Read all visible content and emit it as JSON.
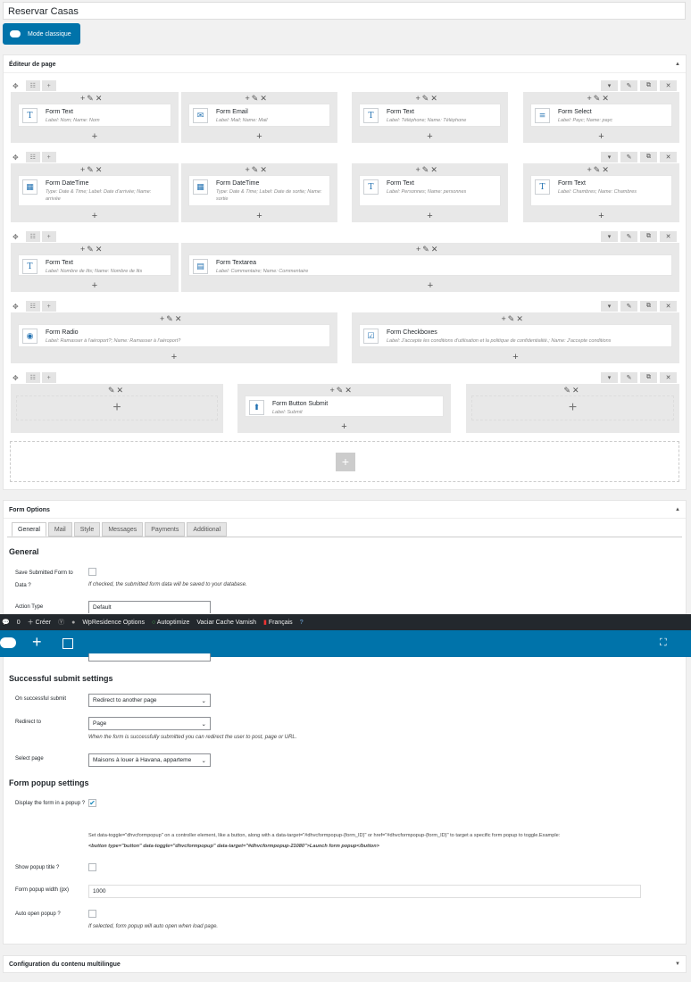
{
  "title": "Reservar Casas",
  "classic_mode": "Mode classique",
  "editor": {
    "title": "Éditeur de page",
    "rows": [
      {
        "cols": [
          {
            "name": "Form Text",
            "desc": "Label: Nom; Name: Nom",
            "icon": "T"
          },
          {
            "name": "Form Email",
            "desc": "Label: Mail; Name: Mail",
            "icon": "✉"
          },
          {
            "name": "Form Text",
            "desc": "Label: Téléphone; Name: Téléphone",
            "icon": "T"
          },
          {
            "name": "Form Select",
            "desc": "Label: Payс; Name: payc",
            "icon": "≡"
          }
        ]
      },
      {
        "cols": [
          {
            "name": "Form DateTime",
            "desc": "Type: Date & Time; Label: Date d'arrivée; Name: arrivée",
            "icon": "▦"
          },
          {
            "name": "Form DateTime",
            "desc": "Type: Date & Time; Label: Date de sortie; Name: sortie",
            "icon": "▦"
          },
          {
            "name": "Form Text",
            "desc": "Label: Personnes; Name: personnes",
            "icon": "T"
          },
          {
            "name": "Form Text",
            "desc": "Label: Chambres; Name: Chambres",
            "icon": "T"
          }
        ]
      },
      {
        "cols": [
          {
            "name": "Form Text",
            "desc": "Label: Nombre de lits; Name: Nombre de lits",
            "icon": "T"
          },
          {
            "name": "Form Textarea",
            "desc": "Label: Commentaire; Name: Commentaire",
            "icon": "▤"
          }
        ]
      },
      {
        "cols": [
          {
            "name": "Form Radio",
            "desc": "Label: Ramasser à l'aéroport?; Name: Ramasser à l'aéroport?",
            "icon": "◉"
          },
          {
            "name": "Form Checkboxes",
            "desc": "Label: J'accepte les conditions d'utilisation et la politique de confidentialité.; Name: J'accepte conditions",
            "icon": "☑"
          }
        ]
      },
      {
        "cols": [
          {
            "name": "Form Button Submit",
            "desc": "Label: Submit",
            "icon": "⬆"
          }
        ]
      }
    ]
  },
  "options": {
    "title": "Form Options",
    "tabs": [
      "General",
      "Mail",
      "Style",
      "Messages",
      "Payments",
      "Additional"
    ],
    "general_heading": "General",
    "save_label": "Save Submitted Form to Data ?",
    "save_hint": "If checked, the submitted form data will be saved to your database.",
    "action_label": "Action Type",
    "action_value": "Default",
    "success_heading": "Successful submit settings",
    "on_success_label": "On successful submit",
    "on_success_value": "Redirect to another page",
    "redirect_label": "Redirect to",
    "redirect_value": "Page",
    "redirect_hint": "When the form is successfully submitted you can redirect the user to post, page or URL.",
    "select_page_label": "Select page",
    "select_page_value": "Maisons à louer à Havana, apparteme",
    "popup_heading": "Form popup settings",
    "display_popup_label": "Display the form in a popup ?",
    "popup_hint1": "Set data-toggle=\"dhvcformpopup\" on a controller element, like a button, along with a data-target=\"#dhvcformpopup-{form_ID}\" or href=\"#dhvcformpopup-{form_ID}\" to target a specific form popup to toggle.Example:",
    "popup_hint2": "<button type=\"button\" data-toggle=\"dhvcformpopup\" data-target=\"#dhvcformpopup-21080\">Launch form popup</button>",
    "show_title_label": "Show popup title ?",
    "width_label": "Form popup width (px)",
    "width_value": "1000",
    "auto_open_label": "Auto open popup ?",
    "auto_open_hint": "If selected, form popup will auto open when load page."
  },
  "multilingual_title": "Configuration du contenu multilingue",
  "adminbar": {
    "comments": "0",
    "create": "Créer",
    "wpresidence": "WpResidence Options",
    "autoptimize": "Autoptimize",
    "varnish": "Vaciar Cache Varnish",
    "lang": "Français"
  }
}
